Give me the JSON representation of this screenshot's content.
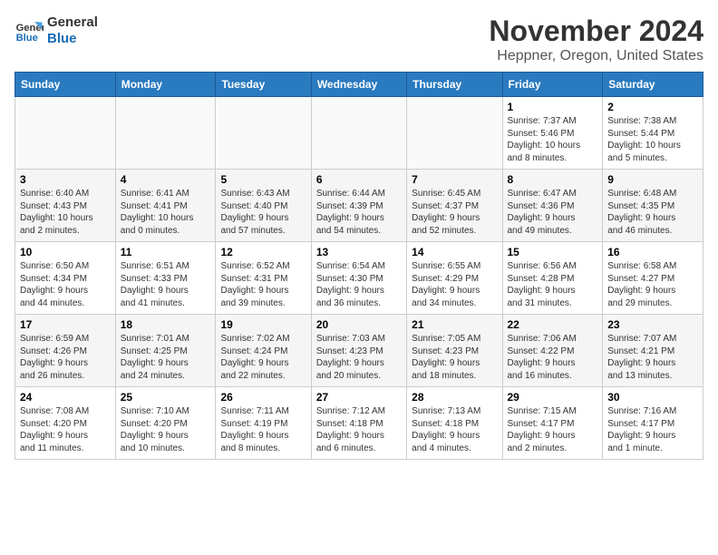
{
  "logo": {
    "line1": "General",
    "line2": "Blue"
  },
  "title": "November 2024",
  "subtitle": "Heppner, Oregon, United States",
  "days_of_week": [
    "Sunday",
    "Monday",
    "Tuesday",
    "Wednesday",
    "Thursday",
    "Friday",
    "Saturday"
  ],
  "weeks": [
    [
      {
        "num": "",
        "info": ""
      },
      {
        "num": "",
        "info": ""
      },
      {
        "num": "",
        "info": ""
      },
      {
        "num": "",
        "info": ""
      },
      {
        "num": "",
        "info": ""
      },
      {
        "num": "1",
        "info": "Sunrise: 7:37 AM\nSunset: 5:46 PM\nDaylight: 10 hours\nand 8 minutes."
      },
      {
        "num": "2",
        "info": "Sunrise: 7:38 AM\nSunset: 5:44 PM\nDaylight: 10 hours\nand 5 minutes."
      }
    ],
    [
      {
        "num": "3",
        "info": "Sunrise: 6:40 AM\nSunset: 4:43 PM\nDaylight: 10 hours\nand 2 minutes."
      },
      {
        "num": "4",
        "info": "Sunrise: 6:41 AM\nSunset: 4:41 PM\nDaylight: 10 hours\nand 0 minutes."
      },
      {
        "num": "5",
        "info": "Sunrise: 6:43 AM\nSunset: 4:40 PM\nDaylight: 9 hours\nand 57 minutes."
      },
      {
        "num": "6",
        "info": "Sunrise: 6:44 AM\nSunset: 4:39 PM\nDaylight: 9 hours\nand 54 minutes."
      },
      {
        "num": "7",
        "info": "Sunrise: 6:45 AM\nSunset: 4:37 PM\nDaylight: 9 hours\nand 52 minutes."
      },
      {
        "num": "8",
        "info": "Sunrise: 6:47 AM\nSunset: 4:36 PM\nDaylight: 9 hours\nand 49 minutes."
      },
      {
        "num": "9",
        "info": "Sunrise: 6:48 AM\nSunset: 4:35 PM\nDaylight: 9 hours\nand 46 minutes."
      }
    ],
    [
      {
        "num": "10",
        "info": "Sunrise: 6:50 AM\nSunset: 4:34 PM\nDaylight: 9 hours\nand 44 minutes."
      },
      {
        "num": "11",
        "info": "Sunrise: 6:51 AM\nSunset: 4:33 PM\nDaylight: 9 hours\nand 41 minutes."
      },
      {
        "num": "12",
        "info": "Sunrise: 6:52 AM\nSunset: 4:31 PM\nDaylight: 9 hours\nand 39 minutes."
      },
      {
        "num": "13",
        "info": "Sunrise: 6:54 AM\nSunset: 4:30 PM\nDaylight: 9 hours\nand 36 minutes."
      },
      {
        "num": "14",
        "info": "Sunrise: 6:55 AM\nSunset: 4:29 PM\nDaylight: 9 hours\nand 34 minutes."
      },
      {
        "num": "15",
        "info": "Sunrise: 6:56 AM\nSunset: 4:28 PM\nDaylight: 9 hours\nand 31 minutes."
      },
      {
        "num": "16",
        "info": "Sunrise: 6:58 AM\nSunset: 4:27 PM\nDaylight: 9 hours\nand 29 minutes."
      }
    ],
    [
      {
        "num": "17",
        "info": "Sunrise: 6:59 AM\nSunset: 4:26 PM\nDaylight: 9 hours\nand 26 minutes."
      },
      {
        "num": "18",
        "info": "Sunrise: 7:01 AM\nSunset: 4:25 PM\nDaylight: 9 hours\nand 24 minutes."
      },
      {
        "num": "19",
        "info": "Sunrise: 7:02 AM\nSunset: 4:24 PM\nDaylight: 9 hours\nand 22 minutes."
      },
      {
        "num": "20",
        "info": "Sunrise: 7:03 AM\nSunset: 4:23 PM\nDaylight: 9 hours\nand 20 minutes."
      },
      {
        "num": "21",
        "info": "Sunrise: 7:05 AM\nSunset: 4:23 PM\nDaylight: 9 hours\nand 18 minutes."
      },
      {
        "num": "22",
        "info": "Sunrise: 7:06 AM\nSunset: 4:22 PM\nDaylight: 9 hours\nand 16 minutes."
      },
      {
        "num": "23",
        "info": "Sunrise: 7:07 AM\nSunset: 4:21 PM\nDaylight: 9 hours\nand 13 minutes."
      }
    ],
    [
      {
        "num": "24",
        "info": "Sunrise: 7:08 AM\nSunset: 4:20 PM\nDaylight: 9 hours\nand 11 minutes."
      },
      {
        "num": "25",
        "info": "Sunrise: 7:10 AM\nSunset: 4:20 PM\nDaylight: 9 hours\nand 10 minutes."
      },
      {
        "num": "26",
        "info": "Sunrise: 7:11 AM\nSunset: 4:19 PM\nDaylight: 9 hours\nand 8 minutes."
      },
      {
        "num": "27",
        "info": "Sunrise: 7:12 AM\nSunset: 4:18 PM\nDaylight: 9 hours\nand 6 minutes."
      },
      {
        "num": "28",
        "info": "Sunrise: 7:13 AM\nSunset: 4:18 PM\nDaylight: 9 hours\nand 4 minutes."
      },
      {
        "num": "29",
        "info": "Sunrise: 7:15 AM\nSunset: 4:17 PM\nDaylight: 9 hours\nand 2 minutes."
      },
      {
        "num": "30",
        "info": "Sunrise: 7:16 AM\nSunset: 4:17 PM\nDaylight: 9 hours\nand 1 minute."
      }
    ]
  ]
}
